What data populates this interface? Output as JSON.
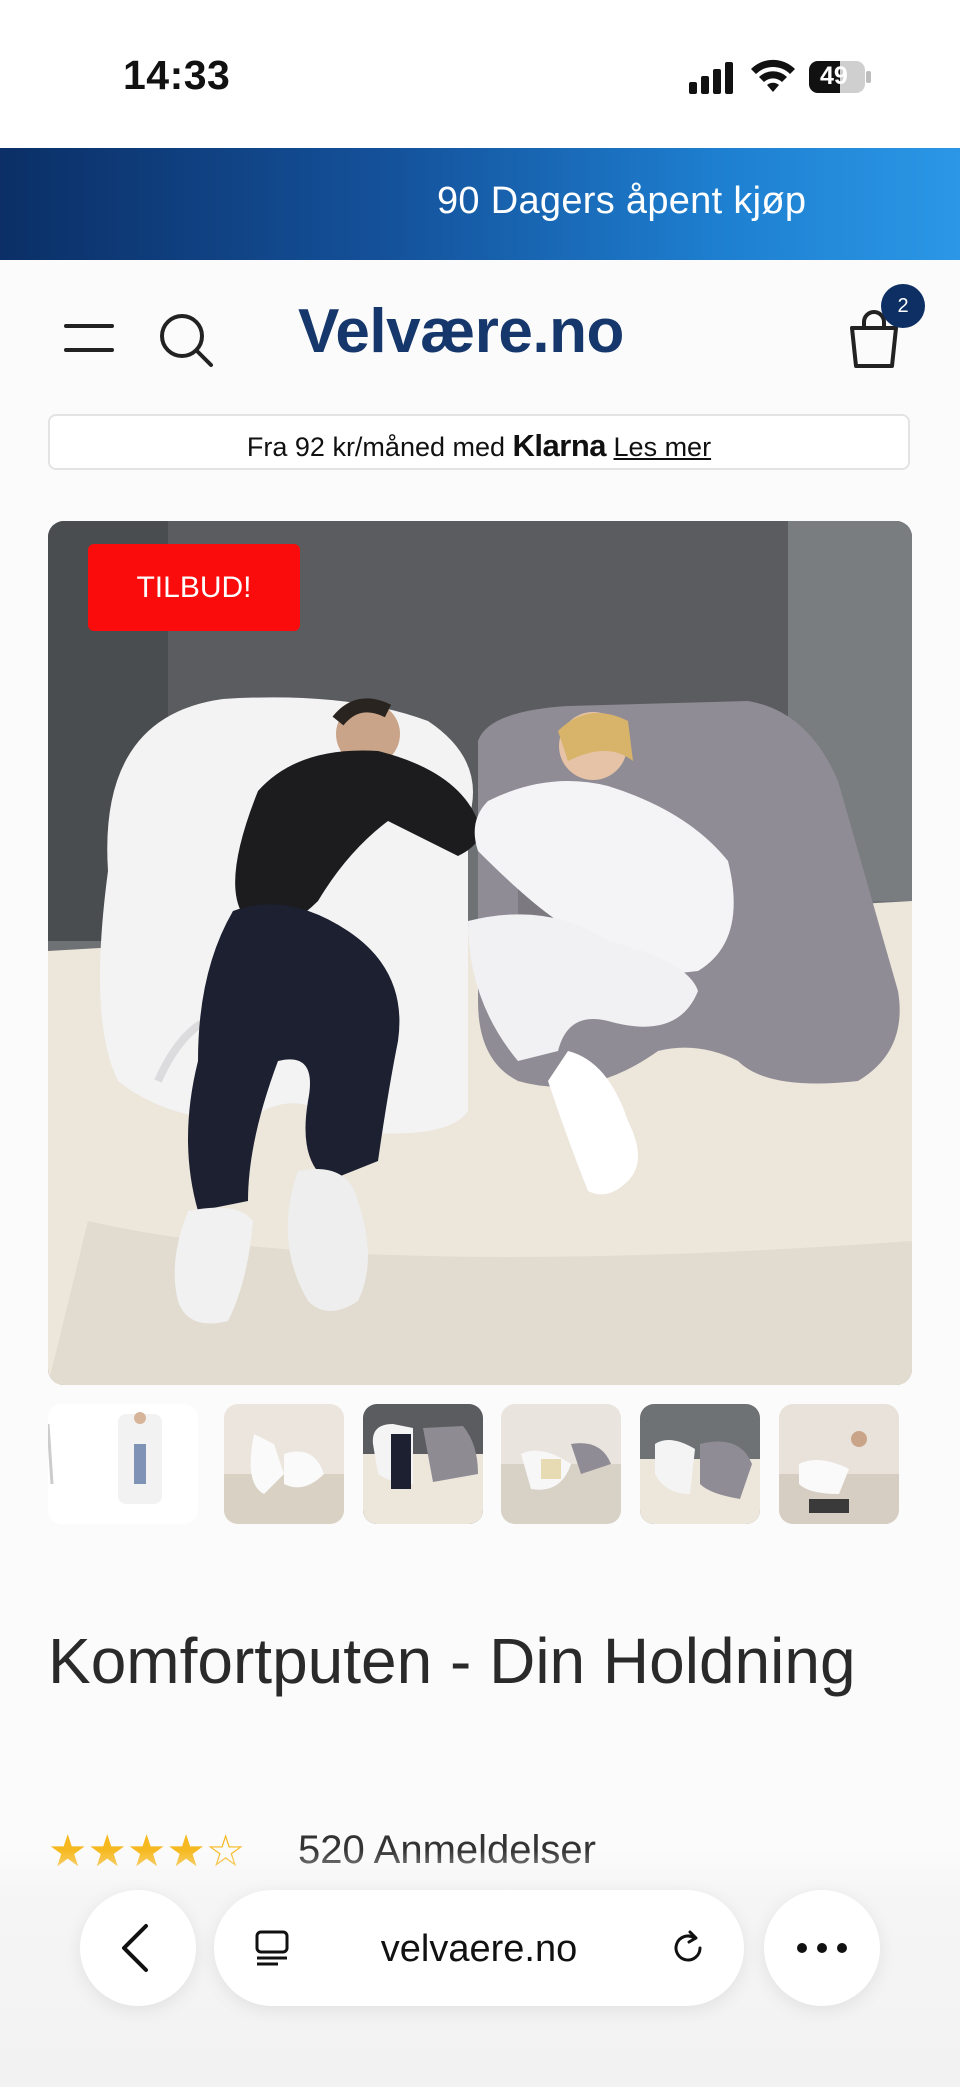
{
  "status_bar": {
    "time": "14:33",
    "battery": "49"
  },
  "promo": {
    "text": "90 Dagers åpent kjøp"
  },
  "header": {
    "logo": "Velvære.no",
    "cart_count": "2"
  },
  "klarna": {
    "prefix": "Fra 92 kr/måned med",
    "brand": "Klarna",
    "link": "Les mer"
  },
  "product": {
    "badge": "TILBUD!",
    "title": "Komfortputen - Din Holdning",
    "rating": 4.5,
    "reviews": "520 Anmeldelser"
  },
  "browser": {
    "url": "velvaere.no"
  },
  "colors": {
    "brand_navy": "#16376b",
    "sale_red": "#fa0c0c",
    "star": "#f6b91f"
  }
}
